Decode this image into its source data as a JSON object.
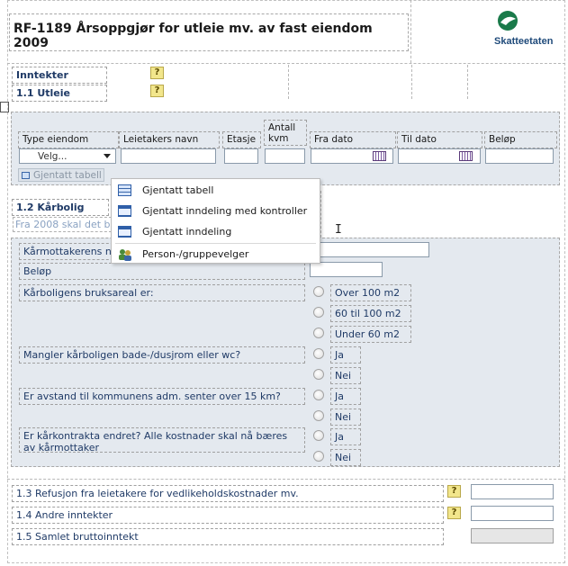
{
  "header": {
    "title": "RF-1189 Årsoppgjør for utleie mv. av fast eiendom 2009",
    "logo_text": "Skatteetaten",
    "logo_color": "#1a7a4a"
  },
  "sections": {
    "inntekter": "Inntekter",
    "utleie": "1.1 Utleie",
    "karbolig": "1.2 Kårbolig",
    "karbolig_note": "Fra 2008 skal det b",
    "refusjon": "1.3 Refusjon fra leietakere for vedlikeholdskostnader mv.",
    "andre": "1.4 Andre inntekter",
    "samlet": "1.5 Samlet bruttoinntekt"
  },
  "help_label": "?",
  "table": {
    "headers": [
      "Type eiendom",
      "Leietakers navn",
      "Etasje",
      "Antall kvm",
      "Fra dato",
      "Til dato",
      "Beløp"
    ],
    "select_value": "Velg...",
    "repeat_button": "Gjentatt tabell"
  },
  "context_menu": {
    "items": [
      "Gjentatt tabell",
      "Gjentatt inndeling med kontroller",
      "Gjentatt inndeling",
      "Person-/gruppevelger"
    ]
  },
  "karbolig": {
    "mottaker_label": "Kårmottakerens n",
    "belop_label": "Beløp",
    "bruksareal_label": "Kårboligens bruksareal er:",
    "bruksareal_options": [
      "Over 100 m2",
      "60 til 100 m2",
      "Under 60 m2"
    ],
    "bad_label": "Mangler kårboligen bade-/dusjrom eller wc?",
    "avstand_label": "Er avstand til kommunens adm. senter over 15 km?",
    "kontrakt_label_1": "Er kårkontrakta endret? Alle kostnader skal nå bæres",
    "kontrakt_label_2": "av kårmottaker",
    "ja": "Ja",
    "nei": "Nei"
  }
}
